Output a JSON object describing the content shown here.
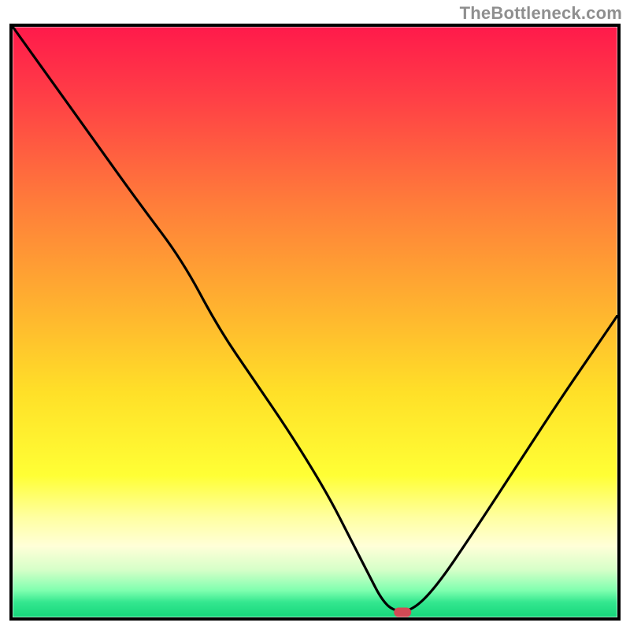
{
  "watermark": "TheBottleneck.com",
  "chart_data": {
    "type": "line",
    "title": "",
    "xlabel": "",
    "ylabel": "",
    "xlim": [
      0,
      100
    ],
    "ylim": [
      0,
      100
    ],
    "background_gradient": {
      "stops": [
        {
          "offset": 0.0,
          "color": "#ff1a4b"
        },
        {
          "offset": 0.12,
          "color": "#ff3f46"
        },
        {
          "offset": 0.3,
          "color": "#ff7d3a"
        },
        {
          "offset": 0.48,
          "color": "#ffb42f"
        },
        {
          "offset": 0.62,
          "color": "#ffe028"
        },
        {
          "offset": 0.76,
          "color": "#ffff35"
        },
        {
          "offset": 0.83,
          "color": "#ffffa0"
        },
        {
          "offset": 0.88,
          "color": "#ffffd8"
        },
        {
          "offset": 0.92,
          "color": "#d6ffc8"
        },
        {
          "offset": 0.955,
          "color": "#7fffaf"
        },
        {
          "offset": 0.975,
          "color": "#34e78f"
        },
        {
          "offset": 1.0,
          "color": "#16d67b"
        }
      ]
    },
    "series": [
      {
        "name": "bottleneck-curve",
        "x": [
          0.0,
          7.0,
          14.0,
          21.0,
          28.0,
          34.0,
          40.0,
          46.0,
          52.0,
          56.0,
          59.0,
          61.0,
          63.0,
          66.0,
          70.0,
          76.0,
          83.0,
          90.0,
          96.0,
          100.0
        ],
        "y": [
          100.0,
          90.0,
          80.0,
          70.0,
          60.5,
          49.0,
          40.0,
          31.0,
          21.0,
          13.0,
          7.0,
          3.0,
          1.0,
          1.0,
          5.0,
          14.0,
          25.0,
          36.0,
          45.0,
          51.0
        ]
      }
    ],
    "marker": {
      "x": 64.5,
      "y": 0.8,
      "color": "#d24a55",
      "shape": "rounded-pill"
    }
  }
}
